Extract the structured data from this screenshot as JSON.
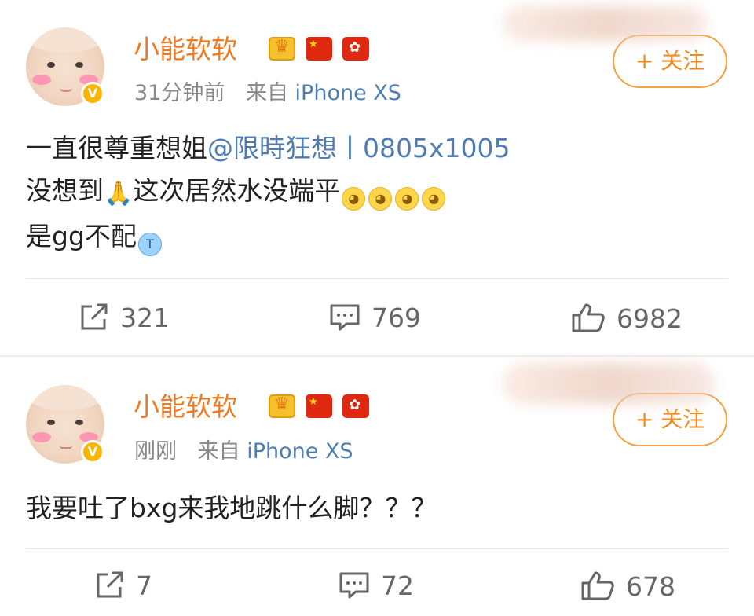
{
  "posts": [
    {
      "username": "小能软软",
      "time": "31分钟前",
      "from_label": "来自",
      "device": "iPhone XS",
      "follow_label": "+ 关注",
      "content": {
        "line1_text": "一直很尊重想姐",
        "line1_mention": "@限時狂想丨0805x1005",
        "line2_text": "没想到",
        "line2_text_after": "这次居然水没端平",
        "line3_text": "是gg不配"
      },
      "actions": {
        "repost": "321",
        "comment": "769",
        "like": "6982"
      }
    },
    {
      "username": "小能软软",
      "time": "刚刚",
      "from_label": "来自",
      "device": "iPhone XS",
      "follow_label": "+ 关注",
      "content": {
        "line1_text": "我要吐了bxg来我地跳什么脚？？？"
      },
      "actions": {
        "repost": "7",
        "comment": "72",
        "like": "678"
      }
    }
  ],
  "icons": {
    "verified": "verified-v-badge",
    "crown": "crown-badge",
    "flag_cn": "china-flag",
    "flag_hk": "hongkong-flag",
    "repost": "repost-icon",
    "comment": "comment-icon",
    "like": "thumbs-up-icon"
  },
  "colors": {
    "username": "#ee7b24",
    "mention": "#507daf",
    "verified": "#f7b500",
    "follow_border": "#f5a041"
  }
}
